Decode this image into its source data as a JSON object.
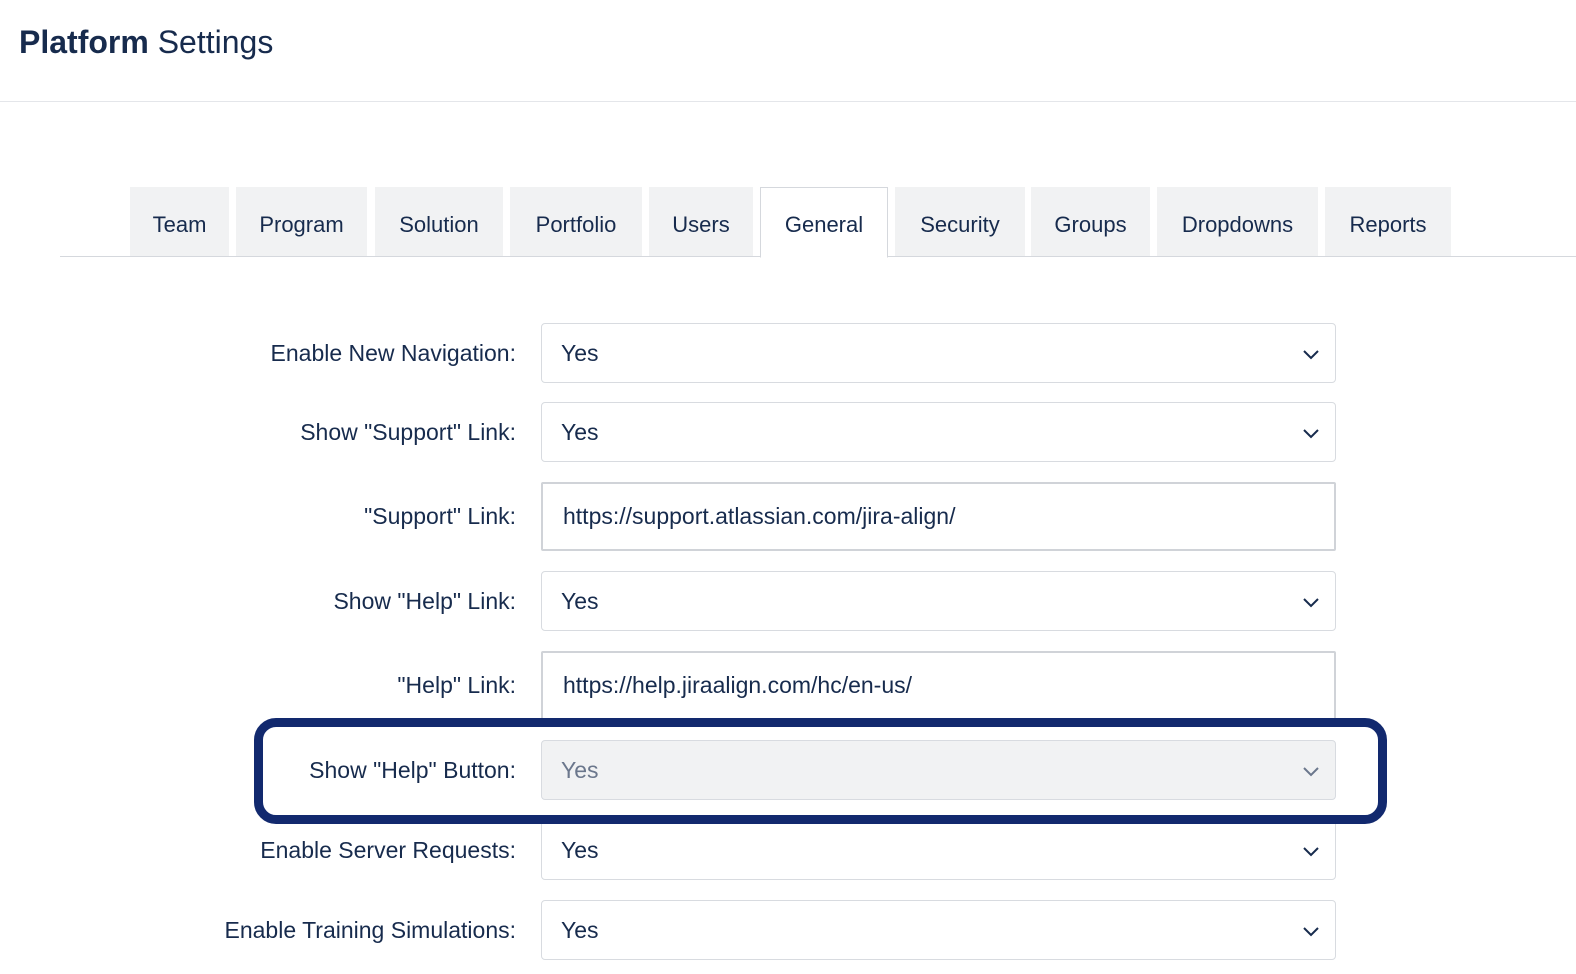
{
  "header": {
    "title_bold": "Platform",
    "title_light": "Settings"
  },
  "tabs": [
    {
      "label": "Team"
    },
    {
      "label": "Program"
    },
    {
      "label": "Solution"
    },
    {
      "label": "Portfolio"
    },
    {
      "label": "Users"
    },
    {
      "label": "General",
      "active": true
    },
    {
      "label": "Security"
    },
    {
      "label": "Groups"
    },
    {
      "label": "Dropdowns"
    },
    {
      "label": "Reports"
    }
  ],
  "settings": {
    "enable_new_navigation": {
      "label": "Enable New Navigation:",
      "value": "Yes"
    },
    "show_support_link": {
      "label": "Show \"Support\" Link:",
      "value": "Yes"
    },
    "support_link": {
      "label": "\"Support\" Link:",
      "value": "https://support.atlassian.com/jira-align/"
    },
    "show_help_link": {
      "label": "Show \"Help\" Link:",
      "value": "Yes"
    },
    "help_link": {
      "label": "\"Help\" Link:",
      "value": "https://help.jiraalign.com/hc/en-us/"
    },
    "show_help_button": {
      "label": "Show \"Help\" Button:",
      "value": "Yes",
      "disabled": true
    },
    "enable_server_requests": {
      "label": "Enable Server Requests:",
      "value": "Yes"
    },
    "enable_training_simulations": {
      "label": "Enable Training Simulations:",
      "value": "Yes"
    }
  },
  "colors": {
    "text": "#172b4d",
    "tab_bg": "#f1f2f3",
    "highlight": "#12296e",
    "disabled_bg": "#f1f2f3"
  },
  "icons": {
    "select_chevron": "chevron-down-icon"
  }
}
